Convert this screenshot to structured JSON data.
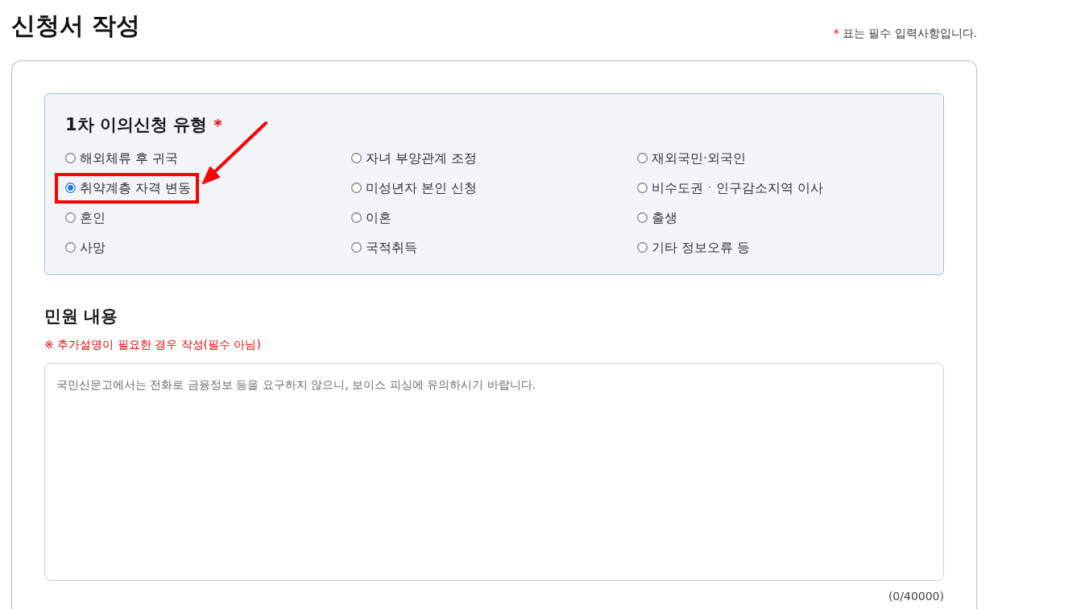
{
  "page_title": "신청서 작성",
  "required_note": {
    "mark": "*",
    "text": "표는 필수 입력사항입니다."
  },
  "appeal_type": {
    "heading": "1차 이의신청 유형",
    "required_mark": "*",
    "options": [
      {
        "label": "해외체류 후 귀국",
        "selected": false,
        "highlighted": false
      },
      {
        "label": "자녀 부양관계 조정",
        "selected": false,
        "highlighted": false
      },
      {
        "label": "재외국민·외국인",
        "selected": false,
        "highlighted": false
      },
      {
        "label": "취약계층 자격 변동",
        "selected": true,
        "highlighted": true
      },
      {
        "label": "미성년자 본인 신청",
        "selected": false,
        "highlighted": false
      },
      {
        "label": "비수도권ㆍ인구감소지역 이사",
        "selected": false,
        "highlighted": false
      },
      {
        "label": "혼인",
        "selected": false,
        "highlighted": false
      },
      {
        "label": "이혼",
        "selected": false,
        "highlighted": false
      },
      {
        "label": "출생",
        "selected": false,
        "highlighted": false
      },
      {
        "label": "사망",
        "selected": false,
        "highlighted": false
      },
      {
        "label": "국적취득",
        "selected": false,
        "highlighted": false
      },
      {
        "label": "기타 정보오류 등",
        "selected": false,
        "highlighted": false
      }
    ]
  },
  "complaint": {
    "heading": "민원 내용",
    "hint": "※ 추가설명이 필요한 경우 작성(필수 아님)",
    "placeholder": "국민신문고에서는 전화로 금융정보 등을 요구하지 않으니, 보이스 피싱에 유의하시기 바랍니다.",
    "counter": "(0/40000)"
  }
}
